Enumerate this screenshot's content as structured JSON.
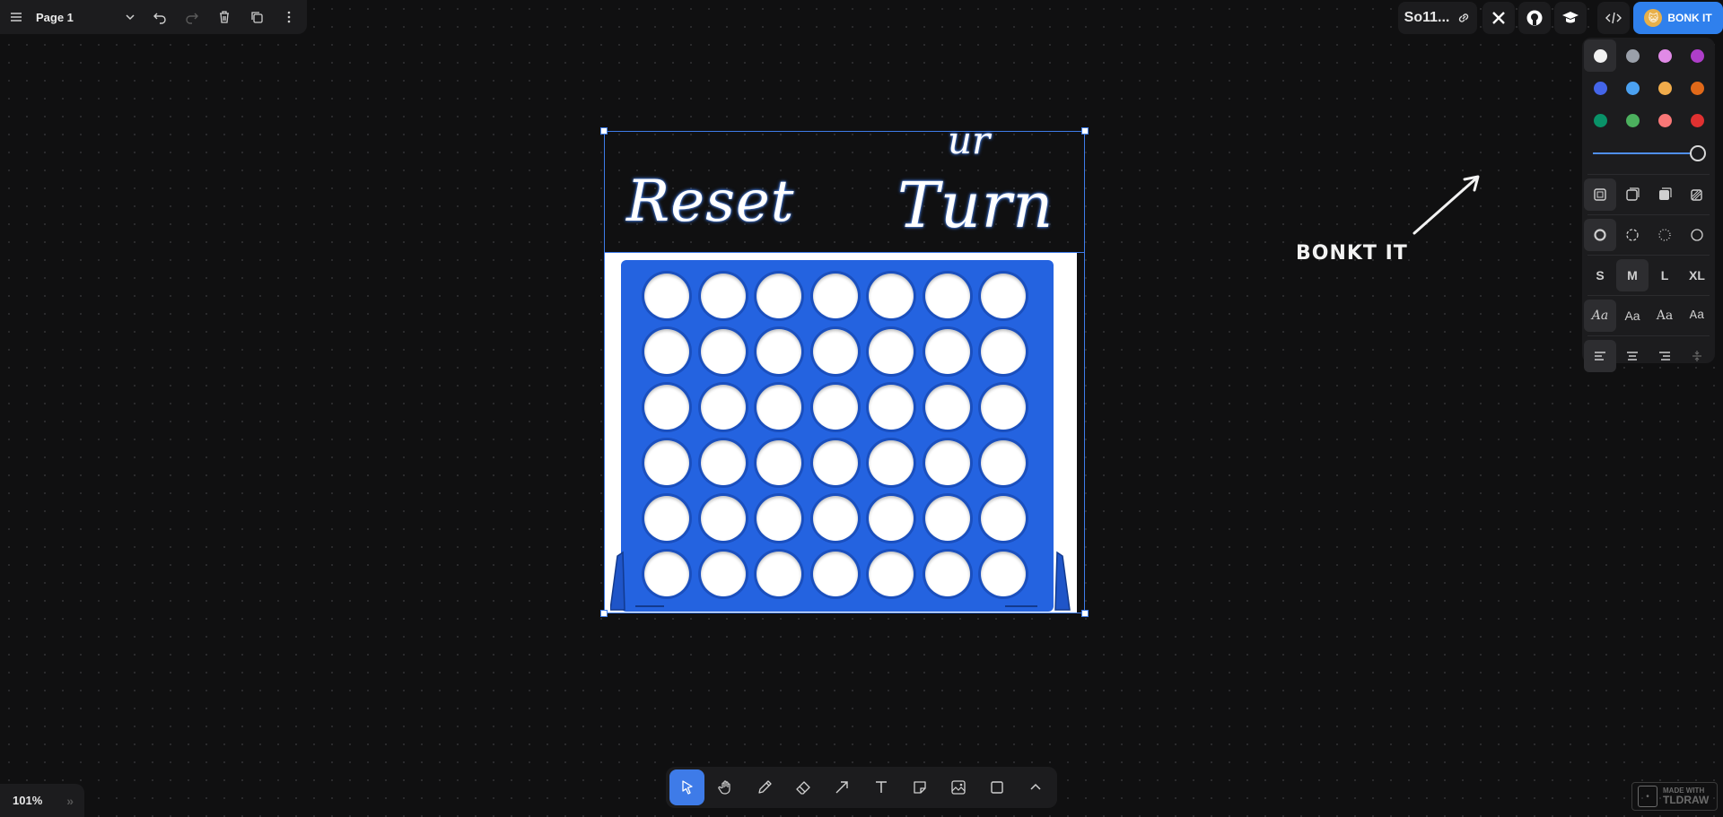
{
  "topbar": {
    "page_name": "Page 1"
  },
  "share": {
    "title": "So11..."
  },
  "bonk_button": {
    "label": "BONK IT"
  },
  "style_panel": {
    "colors": [
      "#f2f2f2",
      "#9aa0aa",
      "#e08ae6",
      "#ae3ec9",
      "#4465e9",
      "#4ba1f1",
      "#f1ac4b",
      "#e16919",
      "#099268",
      "#4cb05e",
      "#f87777",
      "#e03131"
    ],
    "selected_color_index": 0,
    "opacity": 1.0,
    "sizes": [
      "S",
      "M",
      "L",
      "XL"
    ],
    "selected_size": "M",
    "font_labels": [
      "Aa",
      "Aa",
      "Aa",
      "Aa"
    ]
  },
  "canvas": {
    "reset_text": "Reset",
    "turn_text": "Turn",
    "ur_text": "ur",
    "bonkt_text": "BONKT IT",
    "board": {
      "rows": 6,
      "cols": 7
    }
  },
  "zoom": {
    "level": "101%"
  },
  "watermark": {
    "line1": "MADE WITH",
    "line2": "TLDRAW"
  }
}
